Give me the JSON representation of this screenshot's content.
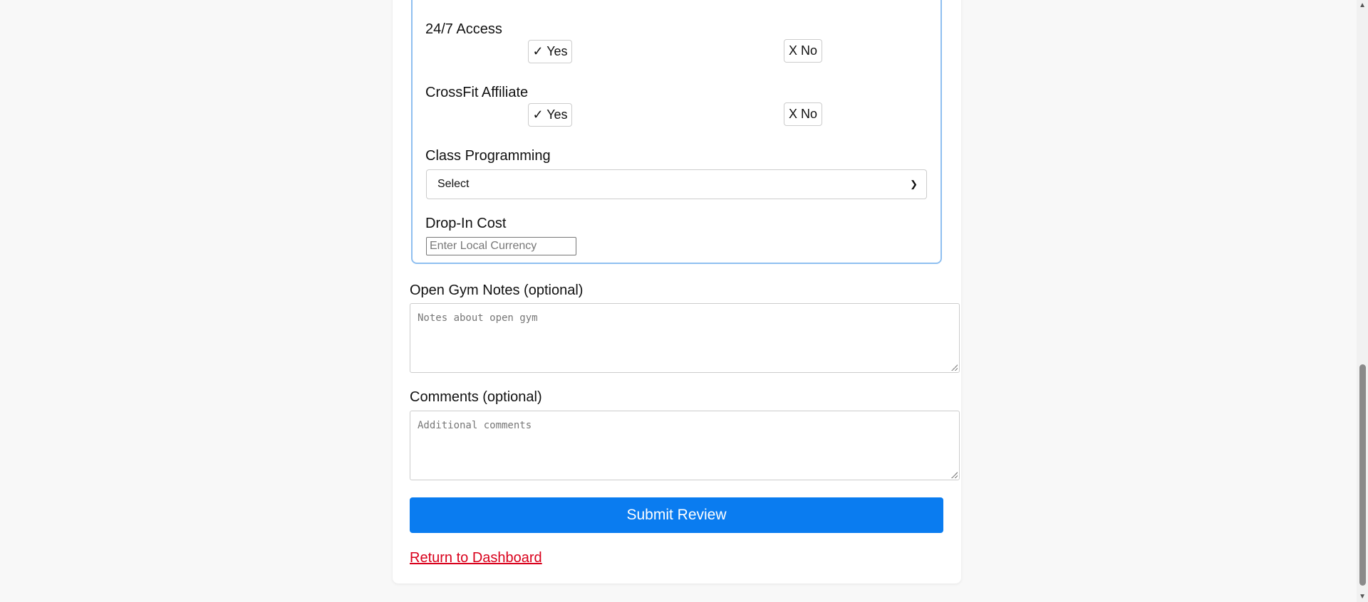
{
  "fields": {
    "access247": {
      "label": "24/7 Access",
      "yes": "✓ Yes",
      "no": "X No"
    },
    "crossfit": {
      "label": "CrossFit Affiliate",
      "yes": "✓ Yes",
      "no": "X No"
    },
    "programming": {
      "label": "Class Programming",
      "selected": "Select"
    },
    "dropin": {
      "label": "Drop-In Cost",
      "placeholder": "Enter Local Currency"
    }
  },
  "open_gym": {
    "label": "Open Gym Notes (optional)",
    "placeholder": "Notes about open gym"
  },
  "comments": {
    "label": "Comments (optional)",
    "placeholder": "Additional comments"
  },
  "submit_label": "Submit Review",
  "return_link": "Return to Dashboard",
  "colors": {
    "accent": "#0a7cf0",
    "link": "#d9001b",
    "fieldset_border": "#8fbff0"
  }
}
